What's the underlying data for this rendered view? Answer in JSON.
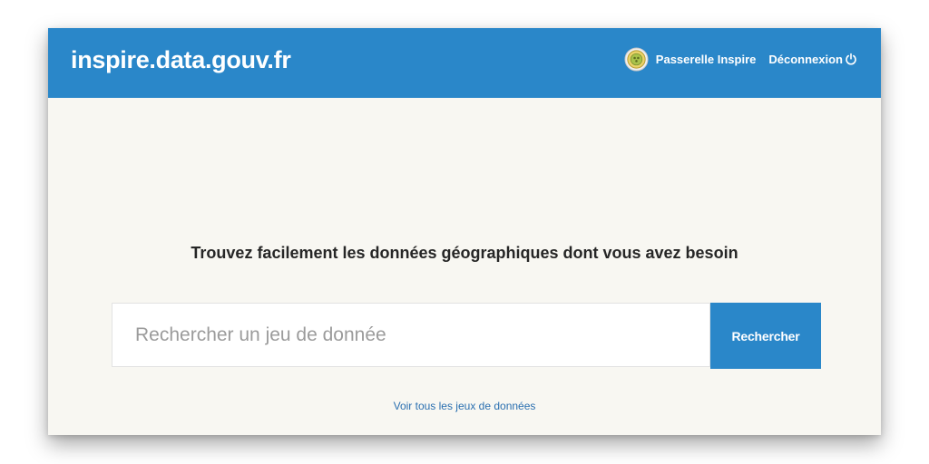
{
  "header": {
    "brand": "inspire.data.gouv.fr",
    "nav": {
      "passerelle_label": "Passerelle Inspire",
      "passerelle_icon": "inspire-emblem-icon",
      "logout_label": "Déconnexion",
      "logout_icon": "power-icon"
    }
  },
  "main": {
    "headline": "Trouvez facilement les données géographiques dont vous avez besoin",
    "search": {
      "placeholder": "Rechercher un jeu de donnée",
      "value": "",
      "button_label": "Rechercher"
    },
    "all_datasets_link": "Voir tous les jeux de données"
  },
  "colors": {
    "accent": "#2a87c9",
    "background": "#f8f7f2",
    "link": "#2a6fb0",
    "headline_text": "#262626"
  }
}
